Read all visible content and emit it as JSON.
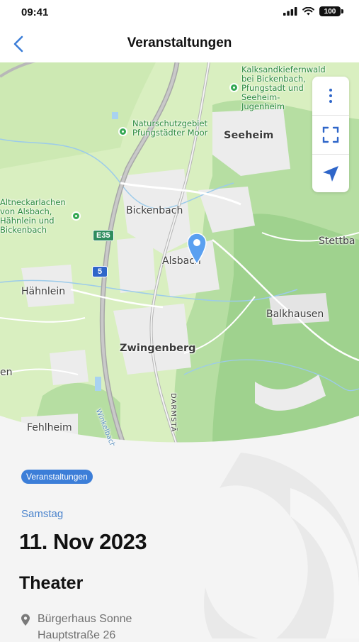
{
  "status": {
    "time": "09:41",
    "battery": "100"
  },
  "nav": {
    "title": "Veranstaltungen"
  },
  "map": {
    "labels": {
      "seeheim": "Seeheim",
      "bickenbach": "Bickenbach",
      "alsbach": "Alsbach",
      "haehnlein": "Hähnlein",
      "zwingenberg": "Zwingenberg",
      "balkhausen": "Balkhausen",
      "stettbach": "Stettba",
      "fehlheim": "Fehlheim",
      "left_cut": "en",
      "nsg_pfungstadt": "Naturschutzgebiet Pfungstädter Moor",
      "kalksand": "Kalksandkiefernwald bei Bickenbach, Pfungstadt und Seeheim-Jugenheim",
      "altneckar": "Altneckarlachen von Alsbach, Hähnlein und Bickenbach",
      "winkelbach": "Winkelbach",
      "darmstadt": "DARMSTÄ"
    },
    "roads": {
      "e35": "E35",
      "a5": "5"
    }
  },
  "event": {
    "tag": "Veranstaltungen",
    "weekday": "Samstag",
    "date": "11. Nov 2023",
    "title": "Theater",
    "location_name": "Bürgerhaus Sonne",
    "location_street": "Hauptstraße 26"
  },
  "colors": {
    "accent": "#3c7ed8",
    "map_land": "#d9efc0",
    "map_forest": "#a9d89a",
    "water": "#a8d2f0"
  }
}
